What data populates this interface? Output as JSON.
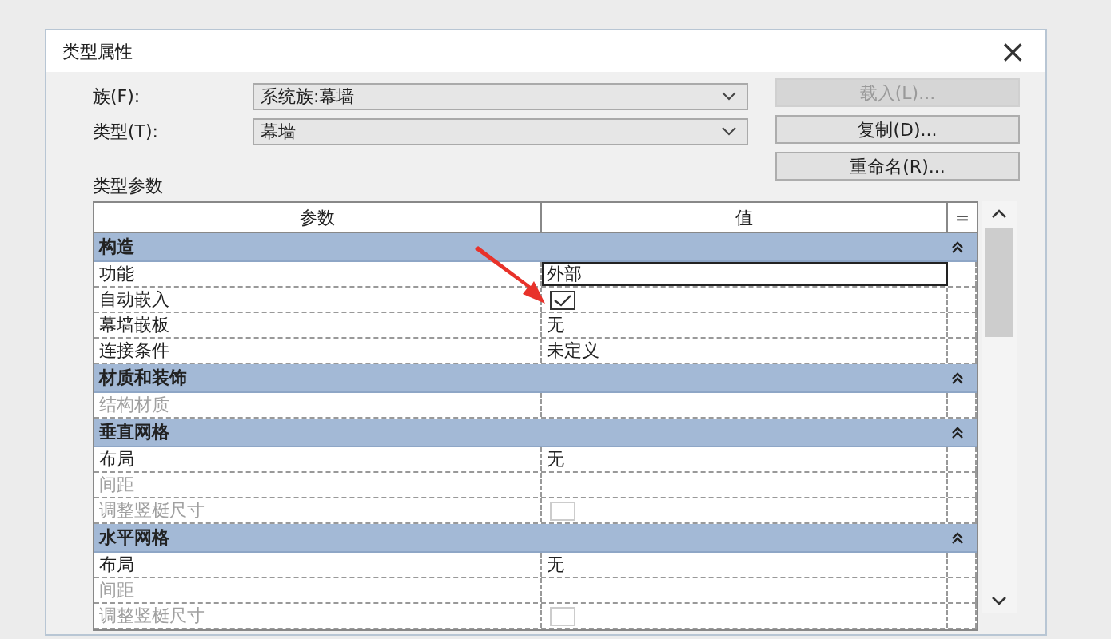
{
  "window": {
    "title": "类型属性",
    "close": "×"
  },
  "family": {
    "label": "族(F):",
    "value": "系统族:幕墙"
  },
  "type": {
    "label": "类型(T):",
    "value": "幕墙"
  },
  "buttons": [
    {
      "label": "载入(L)...",
      "disabled": true
    },
    {
      "label": "复制(D)...",
      "disabled": false
    },
    {
      "label": "重命名(R)...",
      "disabled": false
    }
  ],
  "params_label": "类型参数",
  "table": {
    "columns": [
      "参数",
      "值",
      "="
    ],
    "groups": [
      {
        "title": "构造",
        "expanded": true,
        "rows": [
          {
            "name": "功能",
            "kind": "text",
            "value": "外部",
            "disabled": false,
            "selected": true
          },
          {
            "name": "自动嵌入",
            "kind": "checkbox",
            "checked": true,
            "disabled": false,
            "selected": false
          },
          {
            "name": "幕墙嵌板",
            "kind": "text",
            "value": "无",
            "disabled": false,
            "selected": false
          },
          {
            "name": "连接条件",
            "kind": "text",
            "value": "未定义",
            "disabled": false,
            "selected": false
          }
        ]
      },
      {
        "title": "材质和装饰",
        "expanded": true,
        "rows": [
          {
            "name": "结构材质",
            "kind": "empty",
            "disabled": true,
            "selected": false
          }
        ]
      },
      {
        "title": "垂直网格",
        "expanded": true,
        "rows": [
          {
            "name": "布局",
            "kind": "text",
            "value": "无",
            "disabled": false,
            "selected": false
          },
          {
            "name": "间距",
            "kind": "empty",
            "disabled": true,
            "selected": false
          },
          {
            "name": "调整竖梃尺寸",
            "kind": "checkbox",
            "checked": false,
            "disabled": true,
            "selected": false
          }
        ]
      },
      {
        "title": "水平网格",
        "expanded": true,
        "rows": [
          {
            "name": "布局",
            "kind": "text",
            "value": "无",
            "disabled": false,
            "selected": false
          },
          {
            "name": "间距",
            "kind": "empty",
            "disabled": true,
            "selected": false
          },
          {
            "name": "调整竖梃尺寸",
            "kind": "checkbox",
            "checked": false,
            "disabled": true,
            "selected": false
          }
        ]
      }
    ]
  }
}
